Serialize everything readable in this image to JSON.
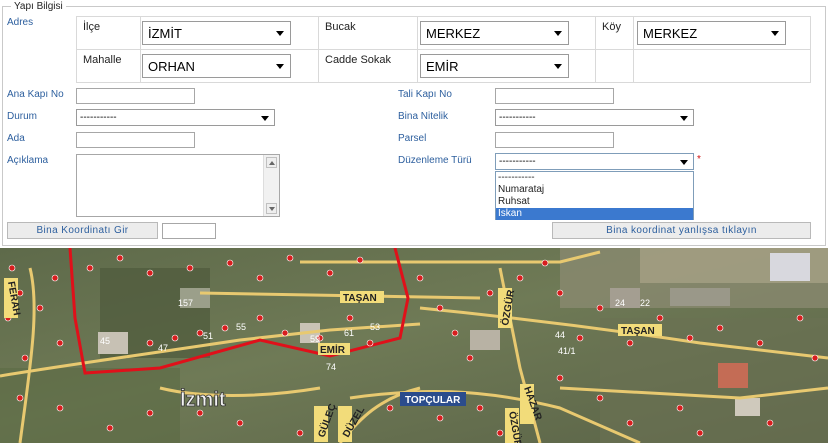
{
  "section": {
    "legend": "Yapı Bilgisi"
  },
  "adres": {
    "label": "Adres",
    "ilce": {
      "label": "İlçe",
      "value": "İZMİT"
    },
    "bucak": {
      "label": "Bucak",
      "value": "MERKEZ"
    },
    "koy": {
      "label": "Köy",
      "value": "MERKEZ"
    },
    "mahalle": {
      "label": "Mahalle",
      "value": "ORHAN"
    },
    "cadde": {
      "label": "Cadde Sokak",
      "value": "EMİR"
    }
  },
  "form": {
    "ana_kapi_no": {
      "label": "Ana Kapı No",
      "value": ""
    },
    "tali_kapi_no": {
      "label": "Tali Kapı No",
      "value": ""
    },
    "durum": {
      "label": "Durum",
      "value": "-----------"
    },
    "bina_nitelik": {
      "label": "Bina Nitelik",
      "value": "-----------"
    },
    "ada": {
      "label": "Ada",
      "value": ""
    },
    "parsel": {
      "label": "Parsel",
      "value": ""
    },
    "aciklama": {
      "label": "Açıklama",
      "value": ""
    },
    "duzenleme_turu": {
      "label": "Düzenleme Türü",
      "value": "-----------",
      "required_mark": "*",
      "options": [
        "-----------",
        "Numarataj",
        "Ruhsat",
        "İskan"
      ],
      "highlighted": "İskan"
    }
  },
  "buttons": {
    "bina_koordinati_gir": "Bina Koordinatı Gir",
    "koordinat_input": "",
    "bina_koordinat_yanlis": "Bina koordinat yanlışsa tıklayın"
  },
  "map": {
    "city_label": "İzmit",
    "street_labels": [
      "TAŞAN",
      "TAŞAN",
      "EMİR",
      "TOPÇULAR",
      "ÖZGÜR",
      "HAZAR",
      "ÖZGÜR",
      "FERAH",
      "GÜLEÇ",
      "DÜZEL"
    ],
    "parcel_numbers": [
      "157",
      "45",
      "47",
      "51",
      "55",
      "59",
      "61",
      "53",
      "74",
      "41/1",
      "44",
      "22",
      "24"
    ],
    "colors": {
      "route": "#e0101a",
      "road": "#e8c970",
      "point": "#d81e1e",
      "label_bg": "#f2dc7a"
    }
  }
}
